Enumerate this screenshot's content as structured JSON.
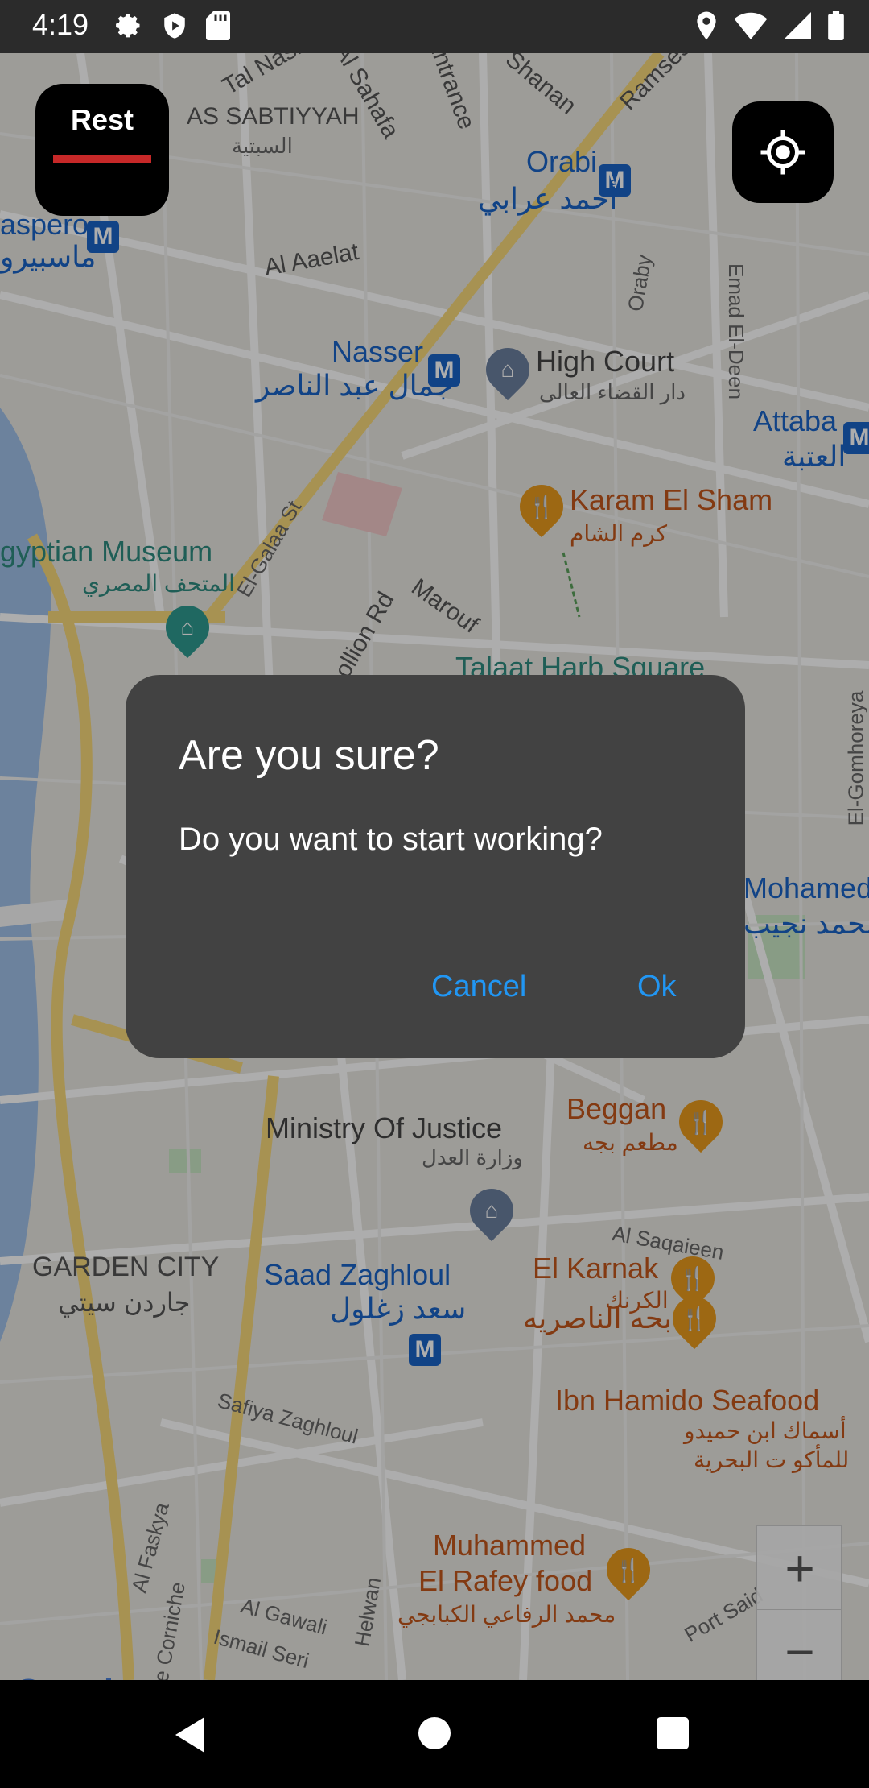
{
  "status_bar": {
    "time": "4:19",
    "left_icons": [
      "settings-icon",
      "shield-play-icon",
      "sd-card-icon"
    ],
    "right_icons": [
      "location-icon",
      "wifi-icon",
      "signal-icon",
      "battery-icon"
    ]
  },
  "map": {
    "labels": {
      "tal_nasr": "Tal Nasr",
      "al_sahafa": "Al Sahafa",
      "entrance": "Entrance",
      "shanan": "Shanan",
      "ramses": "Ramses",
      "as_sabtiyyah": "AS SABTIYYAH",
      "as_sabtiyyah_ar": "السبتية",
      "orabi": "Orabi",
      "orabi_ar": "أحمد عرابي",
      "maspero": "aspero",
      "maspero_ar": "ماسبيرو",
      "al_aaelat": "Al Aaelat",
      "oraby": "Oraby",
      "emad_el_deen": "Emad El-Deen",
      "nasser": "Nasser",
      "nasser_ar": "جمال عبد الناصر",
      "high_court": "High Court",
      "high_court_ar": "دار القضاء العالى",
      "attaba": "Attaba",
      "attaba_ar": "العتبة",
      "el_galaa": "El-Galaa St",
      "karam_el_sham": "Karam El Sham",
      "karam_el_sham_ar": "كرم الشام",
      "egyptian_museum": "gyptian Museum",
      "egyptian_museum_ar": "المتحف المصري",
      "marouf": "Marouf",
      "champollion": "npollion Rd",
      "talaat_harb": "Talaat Harb Square",
      "el_gomhoreya": "El-Gomhoreya",
      "mohamed": "Mohamed",
      "mohamed_ar": "محمد نجيب",
      "beggan": "Beggan",
      "beggan_ar": "مطعم بجه",
      "ministry_justice": "Ministry Of Justice",
      "ministry_justice_ar": "وزارة العدل",
      "al_saqaieen": "Al Saqaieen",
      "el_karnak": "El Karnak",
      "el_karnak_ar": "الكرنك",
      "garden_city": "GARDEN CITY",
      "garden_city_ar": "جاردن سيتي",
      "saad_zaghloul": "Saad Zaghloul",
      "saad_zaghloul_ar": "سعد زغلول",
      "bahh_nasriya_ar": "بحه الناصريه",
      "safiya_zaghloul": "Safiya Zaghloul",
      "ibn_hamido": "Ibn Hamido Seafood",
      "ibn_hamido_ar1": "أسماك ابن حميدو",
      "ibn_hamido_ar2": "للمأكو ت البحرية",
      "al_faskya": "Al Faskya",
      "nile_corniche": "Nile Corniche",
      "helwan": "Helwan",
      "muhammed_rafey1": "Muhammed",
      "muhammed_rafey2": "El Rafey food",
      "muhammed_rafey_ar": "محمد الرفاعي الكبابجي",
      "al_gawali": "Al Gawali",
      "ismail_seri": "Ismail Seri",
      "port_said": "Port Said"
    },
    "metro_glyph": "M",
    "google": "Google",
    "zoom_in": "+",
    "zoom_out": "−"
  },
  "rest_button": {
    "label": "Rest",
    "indicator_color": "#c62828"
  },
  "dialog": {
    "title": "Are you sure?",
    "message": "Do you want to start working?",
    "cancel_label": "Cancel",
    "ok_label": "Ok",
    "accent": "#2196f3"
  }
}
